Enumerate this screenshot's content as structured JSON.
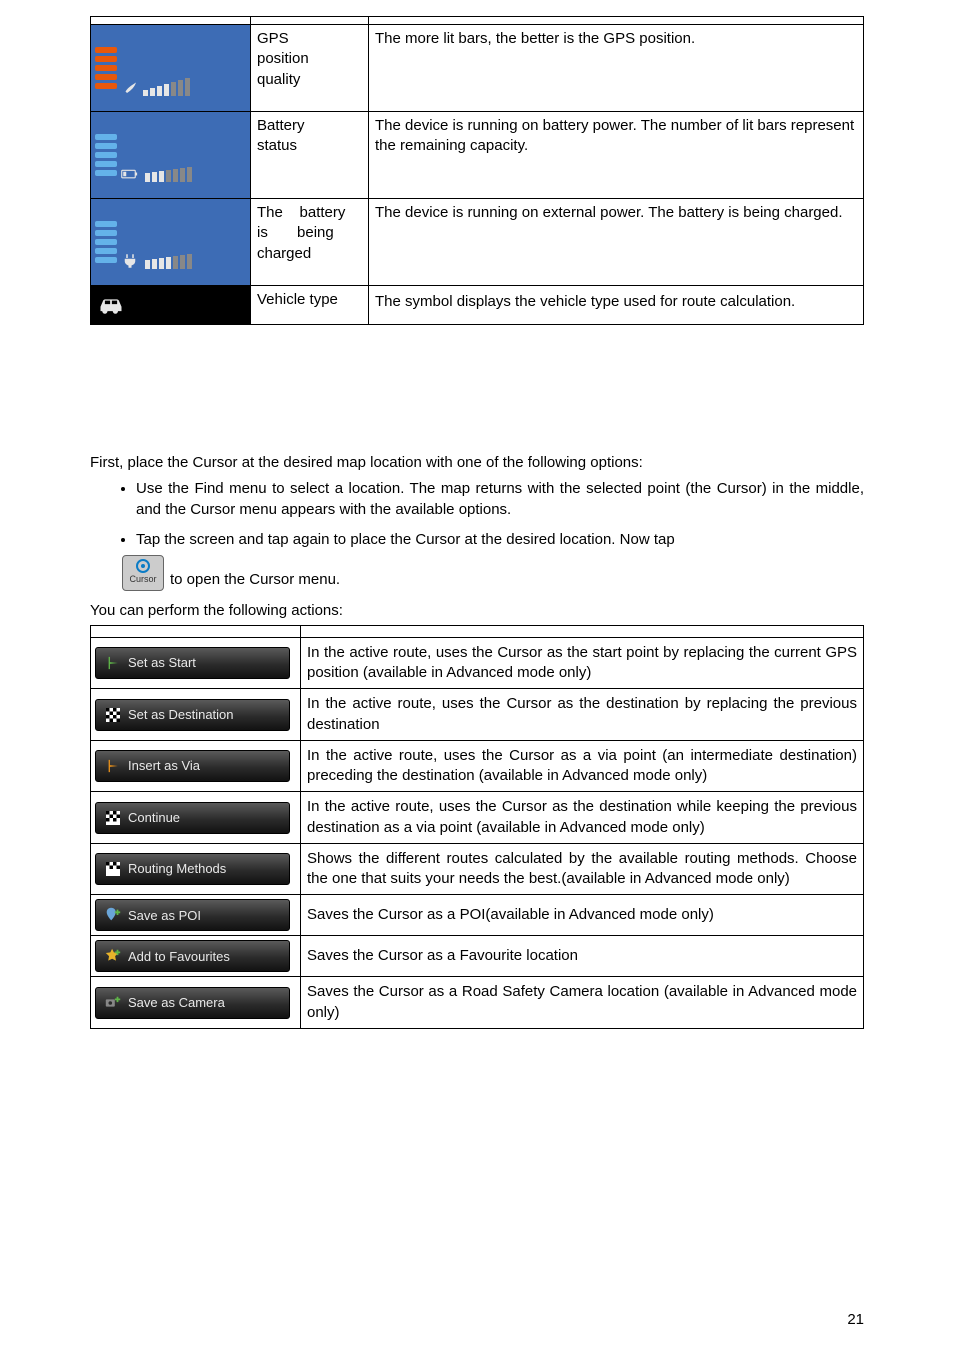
{
  "status_table": {
    "rows": [
      {
        "name_html": "GPS\nposition\nquality",
        "desc": "The more lit bars, the better is the GPS position."
      },
      {
        "name_html": "Battery\nstatus",
        "desc": "The device is running on battery power. The number of lit bars represent the remaining capacity."
      },
      {
        "name_html": "The battery\nis being\ncharged",
        "desc": "The device is running on external power. The battery is being charged."
      },
      {
        "name_html": "Vehicle type",
        "desc": "The symbol displays the vehicle type used for route calculation."
      }
    ]
  },
  "intro": "First, place the Cursor at the desired map location with one of the following options:",
  "bullets": [
    "Use the Find menu to select a location. The map returns with the selected point (the Cursor) in the middle, and the Cursor menu appears with the available options.",
    "Tap the screen and tap again to place the Cursor at the desired location. Now tap"
  ],
  "cursor_tail": " to open the Cursor menu.",
  "cursor_label": "Cursor",
  "after_bullets": "You can perform the following actions:",
  "actions": [
    {
      "label": "Set as Start",
      "desc": "In the active route, uses the Cursor as the start point by replacing the current GPS position (available in Advanced mode only)"
    },
    {
      "label": "Set as Destination",
      "desc": "In the active route, uses the Cursor as the destination by replacing the previous destination"
    },
    {
      "label": "Insert as Via",
      "desc": "In the active route, uses the Cursor as a via point (an intermediate destination) preceding the destination (available in Advanced mode only)"
    },
    {
      "label": "Continue",
      "desc": "In the active route, uses the Cursor as the destination while keeping the previous destination as a via point (available in Advanced mode only)"
    },
    {
      "label": "Routing Methods",
      "desc": "Shows the different routes calculated by the available routing methods. Choose the one that suits your needs the best.(available in Advanced mode only)"
    },
    {
      "label": "Save as POI",
      "desc": "Saves the Cursor as a POI(available in Advanced mode only)"
    },
    {
      "label": "Add to Favourites",
      "desc": "Saves the Cursor as a Favourite location"
    },
    {
      "label": "Save as Camera",
      "desc": "Saves the Cursor as a Road Safety Camera location (available in Advanced mode only)"
    }
  ],
  "page_number": "21"
}
